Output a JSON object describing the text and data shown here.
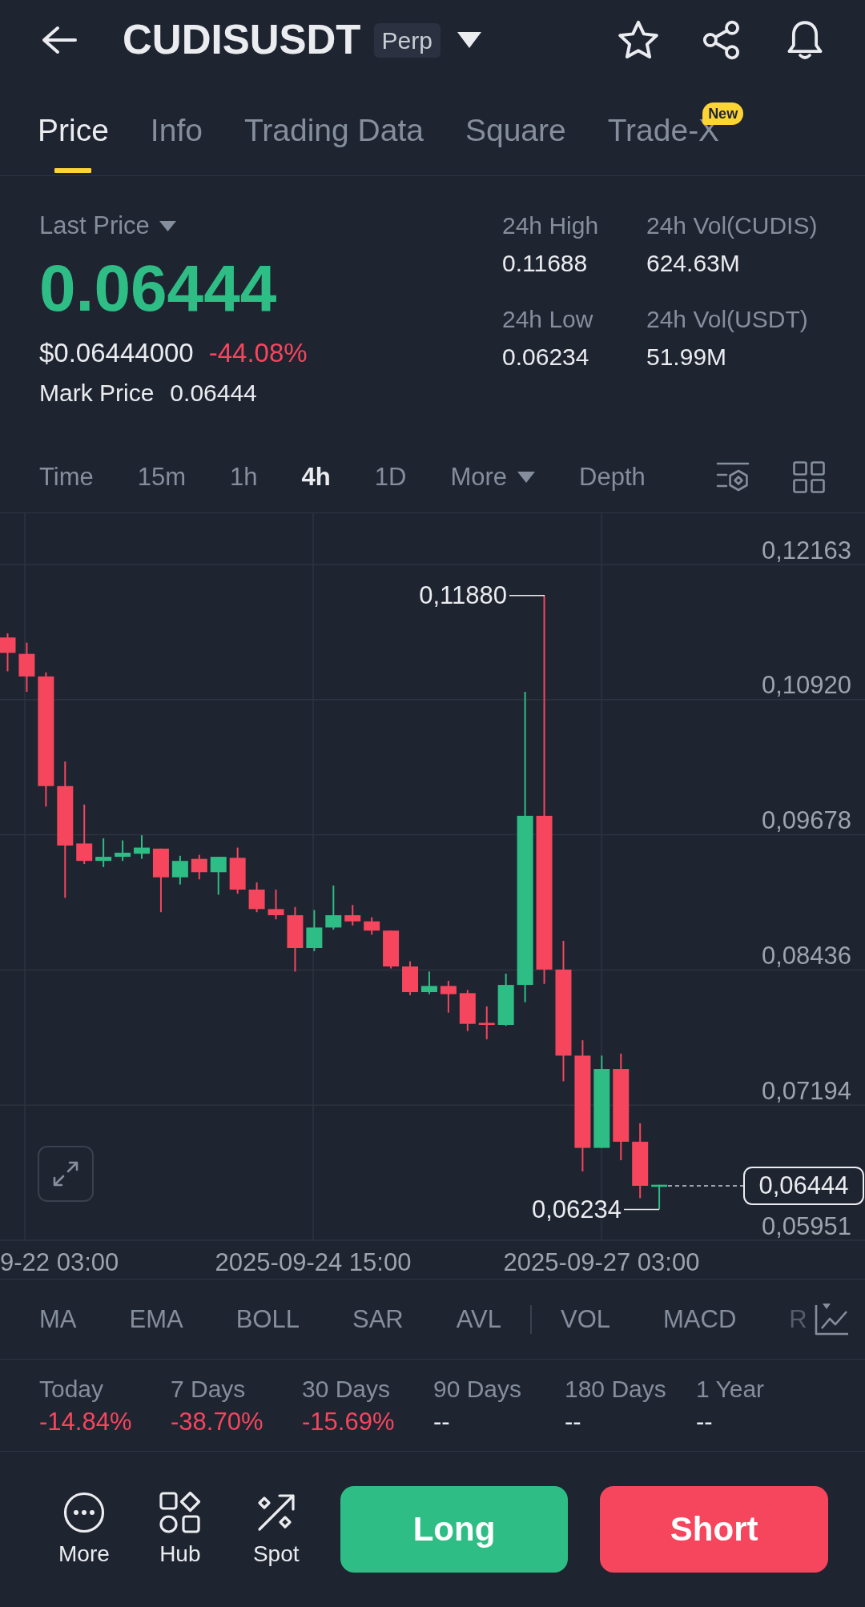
{
  "header": {
    "title": "CUDISUSDT",
    "tag": "Perp",
    "favorite": false
  },
  "tabs": [
    {
      "label": "Price",
      "selected": true
    },
    {
      "label": "Info",
      "selected": false
    },
    {
      "label": "Trading Data",
      "selected": false
    },
    {
      "label": "Square",
      "selected": false
    },
    {
      "label": "Trade-X",
      "selected": false,
      "badge": "New"
    }
  ],
  "ticker": {
    "selector": "Last Price",
    "last_price": "0.06444",
    "last_price_rising": true,
    "usd_price": "$0.06444000",
    "change": "-44.08%",
    "change_negative": true,
    "mark_label": "Mark Price",
    "mark_price": "0.06444",
    "stats": [
      {
        "label": "24h High",
        "value": "0.11688"
      },
      {
        "label": "24h Vol(CUDIS)",
        "value": "624.63M"
      },
      {
        "label": "24h Low",
        "value": "0.06234"
      },
      {
        "label": "24h Vol(USDT)",
        "value": "51.99M"
      }
    ]
  },
  "intervals": [
    {
      "label": "Time",
      "kind": "tab",
      "selected": false
    },
    {
      "label": "15m",
      "kind": "tab",
      "selected": false
    },
    {
      "label": "1h",
      "kind": "tab",
      "selected": false
    },
    {
      "label": "4h",
      "kind": "tab",
      "selected": true
    },
    {
      "label": "1D",
      "kind": "tab",
      "selected": false
    },
    {
      "label": "More",
      "kind": "dropdown",
      "selected": false
    },
    {
      "label": "Depth",
      "kind": "tab",
      "selected": false
    }
  ],
  "chart": {
    "price_axis": [
      "0,12163",
      "0,10920",
      "0,09678",
      "0,08436",
      "0,07194",
      "0,05951"
    ],
    "time_axis": [
      "9-22 03:00",
      "2025-09-24 15:00",
      "2025-09-27 03:00"
    ],
    "high_label": "0,11880",
    "low_label": "0,06234",
    "last_price": "0,06444"
  },
  "indicators": {
    "main": [
      "MA",
      "EMA",
      "BOLL",
      "SAR",
      "AVL"
    ],
    "sub": [
      "VOL",
      "MACD",
      "R"
    ]
  },
  "performance": [
    {
      "label": "Today",
      "value": "-14.84%",
      "negative": true
    },
    {
      "label": "7 Days",
      "value": "-38.70%",
      "negative": true
    },
    {
      "label": "30 Days",
      "value": "-15.69%",
      "negative": true
    },
    {
      "label": "90 Days",
      "value": "--",
      "negative": false
    },
    {
      "label": "180 Days",
      "value": "--",
      "negative": false
    },
    {
      "label": "1 Year",
      "value": "--",
      "negative": false
    }
  ],
  "actions": [
    "More",
    "Hub",
    "Spot"
  ],
  "trade_buttons": [
    {
      "label": "Long",
      "kind": "buy"
    },
    {
      "label": "Short",
      "kind": "sell"
    }
  ]
}
